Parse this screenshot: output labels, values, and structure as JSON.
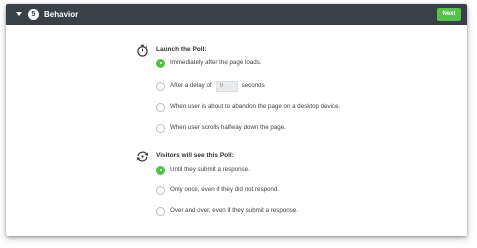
{
  "header": {
    "step_number": "5",
    "title": "Behavior",
    "next_label": "Next"
  },
  "launch": {
    "title": "Launch the Poll:",
    "options": [
      {
        "label": "Immediately after the page loads.",
        "checked": true
      },
      {
        "label": "After a delay of",
        "checked": false,
        "input_placeholder": "0",
        "suffix": "seconds"
      },
      {
        "label": "When user is about to abandon the page on a desktop device.",
        "checked": false
      },
      {
        "label": "When user scrolls halfway down the page.",
        "checked": false
      }
    ]
  },
  "visibility": {
    "title": "Visitors will see this Poll:",
    "options": [
      {
        "label": "Until they submit a response.",
        "checked": true
      },
      {
        "label": "Only once, even if they did not respond.",
        "checked": false
      },
      {
        "label": "Over and over, even if they submit a response.",
        "checked": false
      }
    ]
  },
  "colors": {
    "header_bg": "#3a4048",
    "accent_green": "#52c24a"
  },
  "icons": {
    "collapse": "caret-down-icon",
    "launch": "stopwatch-icon",
    "visibility": "repeat-icon"
  }
}
